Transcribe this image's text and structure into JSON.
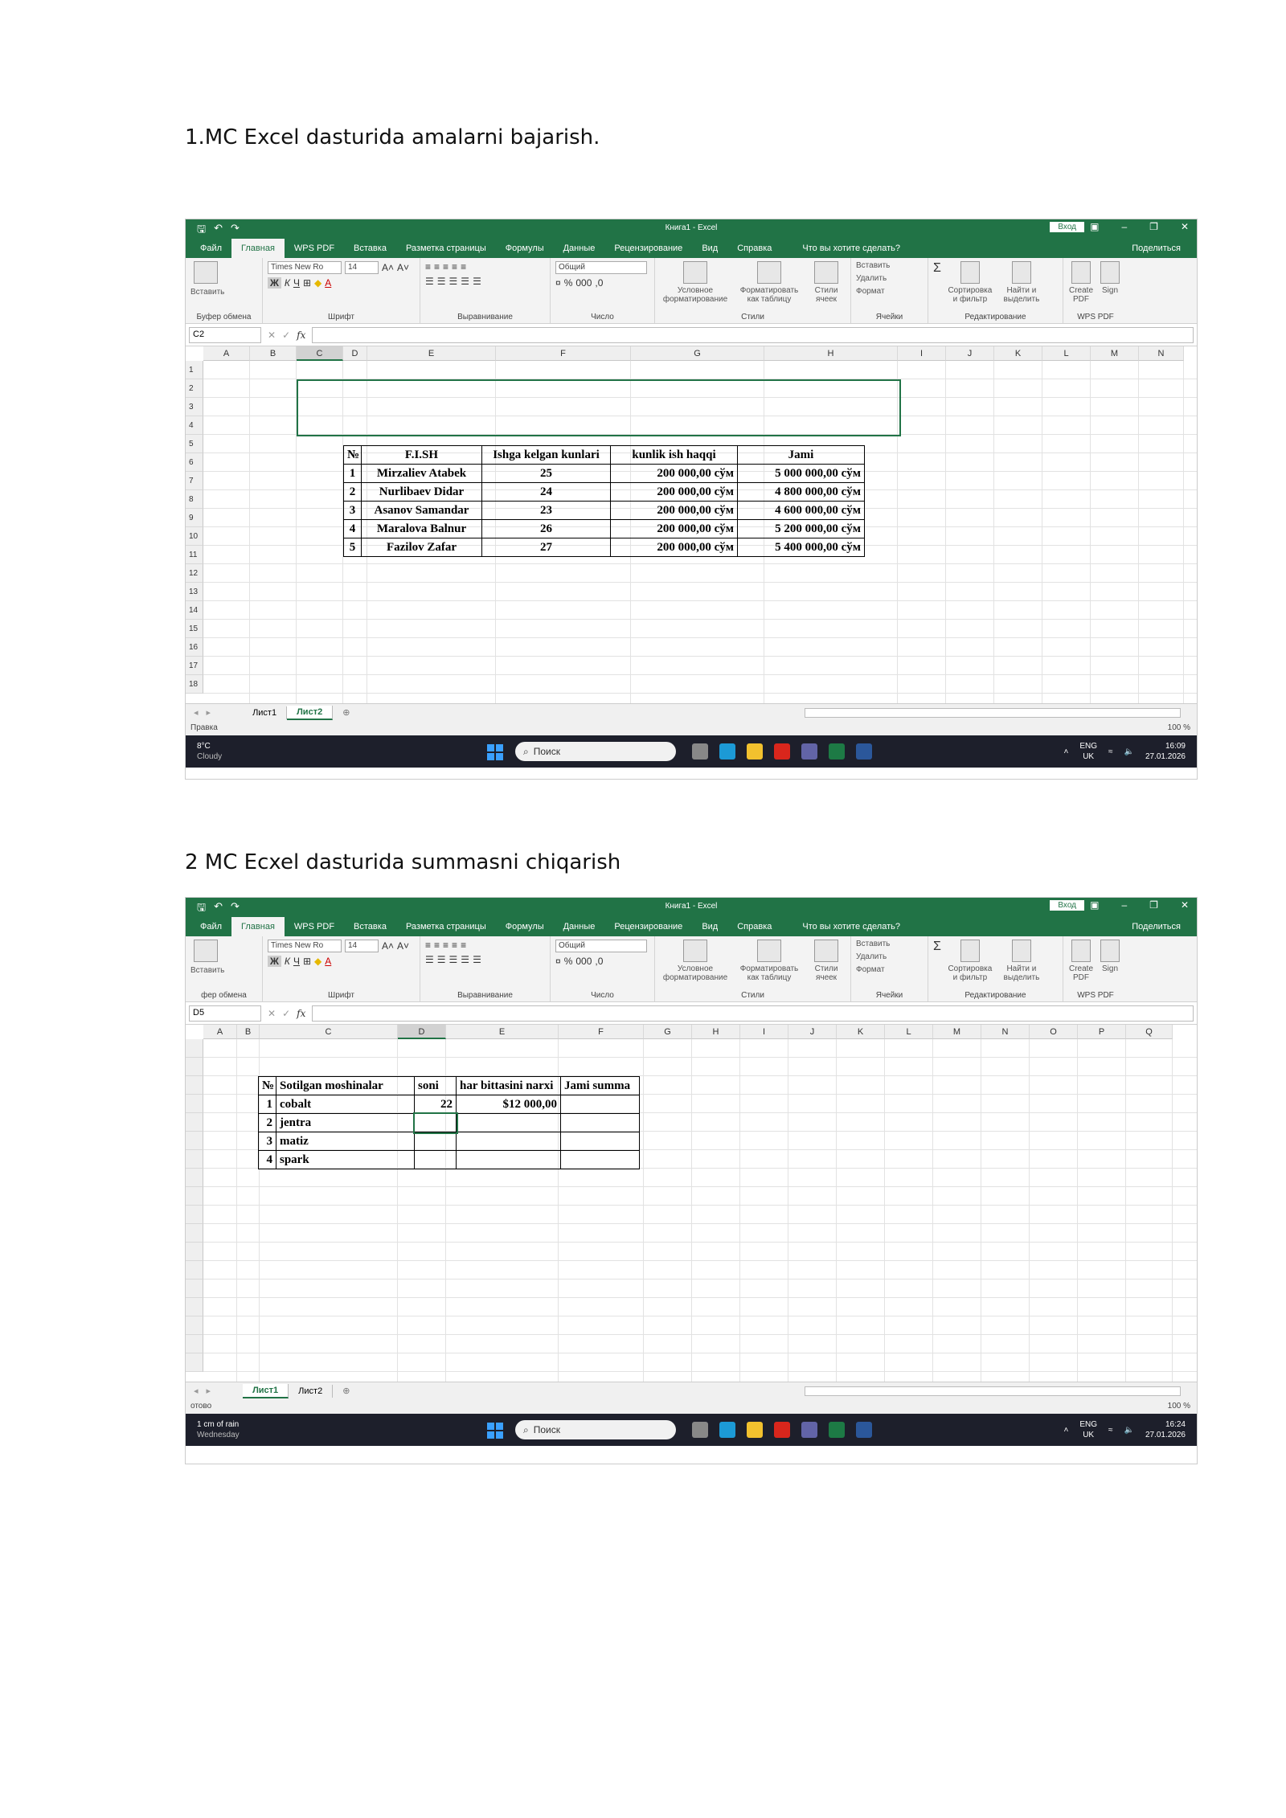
{
  "section1": {
    "heading": "1.MC Excel dasturida amalarni bajarish."
  },
  "section2": {
    "heading": "2 MC Ecxel dasturida summasni chiqarish"
  },
  "excel1": {
    "title": "Книга1 - Excel",
    "signin": "Вход",
    "share": "Поделиться",
    "menu": [
      "Файл",
      "Главная",
      "WPS PDF",
      "Вставка",
      "Разметка страницы",
      "Формулы",
      "Данные",
      "Рецензирование",
      "Вид",
      "Справка",
      "Что вы хотите сделать?"
    ],
    "ribbon": {
      "clipboard": "Буфер обмена",
      "paste": "Вставить",
      "font_group": "Шрифт",
      "font_name": "Times New Ro",
      "font_size": "14",
      "align_group": "Выравнивание",
      "number_group": "Число",
      "number_format": "Общий",
      "styles_group": "Стили",
      "cond_format": "Условное форматирование",
      "format_table": "Форматировать как таблицу",
      "cell_styles": "Стили ячеек",
      "cells_group": "Ячейки",
      "insert": "Вставить",
      "delete": "Удалить",
      "format": "Формат",
      "edit_group": "Редактирование",
      "sort": "Сортировка и фильтр",
      "find": "Найти и выделить",
      "wps_group": "WPS PDF",
      "create_pdf": "Create PDF",
      "sign": "Sign"
    },
    "namebox": "C2",
    "columns": [
      "A",
      "B",
      "C",
      "D",
      "E",
      "F",
      "G",
      "H",
      "I",
      "J",
      "K",
      "L",
      "M",
      "N"
    ],
    "rows": [
      "1",
      "2",
      "3",
      "4",
      "5",
      "6",
      "7",
      "8",
      "9",
      "10",
      "11",
      "12",
      "13",
      "14",
      "15",
      "16",
      "17",
      "18"
    ],
    "table": {
      "headers": [
        "№",
        "F.I.SH",
        "Ishga kelgan kunlari",
        "kunlik ish haqqi",
        "Jami"
      ],
      "rows": [
        [
          "1",
          "Mirzaliev Atabek",
          "25",
          "200 000,00 сўм",
          "5 000 000,00 сўм"
        ],
        [
          "2",
          "Nurlibaev Didar",
          "24",
          "200 000,00 сўм",
          "4 800 000,00 сўм"
        ],
        [
          "3",
          "Asanov Samandar",
          "23",
          "200 000,00 сўм",
          "4 600 000,00 сўм"
        ],
        [
          "4",
          "Maralova Balnur",
          "26",
          "200 000,00 сўм",
          "5 200 000,00 сўм"
        ],
        [
          "5",
          "Fazilov Zafar",
          "27",
          "200 000,00 сўм",
          "5 400 000,00 сўм"
        ]
      ]
    },
    "sheets": [
      "Лист1",
      "Лист2"
    ],
    "active_sheet": 1,
    "status": "Правка",
    "zoom": "100 %",
    "weather_temp": "8°C",
    "weather_desc": "Cloudy",
    "search": "Поиск",
    "lang": "ENG",
    "lang2": "UK",
    "time": "16:09",
    "date": "27.01.2026"
  },
  "excel2": {
    "title": "Книга1 - Excel",
    "signin": "Вход",
    "share": "Поделиться",
    "menu": [
      "Файл",
      "Главная",
      "WPS PDF",
      "Вставка",
      "Разметка страницы",
      "Формулы",
      "Данные",
      "Рецензирование",
      "Вид",
      "Справка",
      "Что вы хотите сделать?"
    ],
    "ribbon": {
      "clipboard": "фер обмена",
      "paste": "Вставить",
      "font_group": "Шрифт",
      "font_name": "Times New Ro",
      "font_size": "14",
      "align_group": "Выравнивание",
      "number_group": "Число",
      "number_format": "Общий",
      "styles_group": "Стили",
      "cond_format": "Условное форматирование",
      "format_table": "Форматировать как таблицу",
      "cell_styles": "Стили ячеек",
      "cells_group": "Ячейки",
      "insert": "Вставить",
      "delete": "Удалить",
      "format": "Формат",
      "edit_group": "Редактирование",
      "sort": "Сортировка и фильтр",
      "find": "Найти и выделить",
      "wps_group": "WPS PDF",
      "create_pdf": "Create PDF",
      "sign": "Sign"
    },
    "namebox": "D5",
    "columns": [
      "A",
      "B",
      "C",
      "D",
      "E",
      "F",
      "G",
      "H",
      "I",
      "J",
      "K",
      "L",
      "M",
      "N",
      "O",
      "P",
      "Q"
    ],
    "table": {
      "headers": [
        "№",
        "Sotilgan moshinalar",
        "soni",
        "har bittasini narxi",
        "Jami summa"
      ],
      "rows": [
        [
          "1",
          "cobalt",
          "22",
          "$12 000,00",
          ""
        ],
        [
          "2",
          "jentra",
          "",
          "",
          ""
        ],
        [
          "3",
          "matiz",
          "",
          "",
          ""
        ],
        [
          "4",
          "spark",
          "",
          "",
          ""
        ]
      ]
    },
    "sheets": [
      "Лист1",
      "Лист2"
    ],
    "active_sheet": 0,
    "status": "отово",
    "zoom": "100 %",
    "weather_temp": "1 cm of rain",
    "weather_desc": "Wednesday",
    "search": "Поиск",
    "lang": "ENG",
    "lang2": "UK",
    "time": "16:24",
    "date": "27.01.2026"
  }
}
